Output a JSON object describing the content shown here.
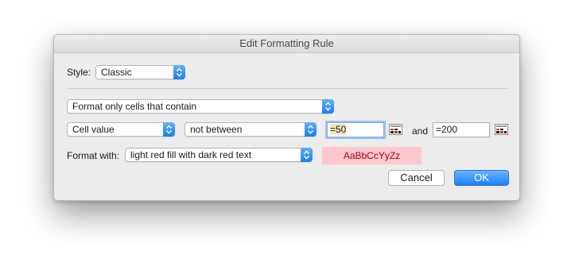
{
  "dialog": {
    "title": "Edit Formatting Rule"
  },
  "style": {
    "label": "Style:",
    "value": "Classic"
  },
  "rule": {
    "type_value": "Format only cells that contain",
    "criteria_value": "Cell value",
    "operator_value": "not between",
    "value1": "=50",
    "and_label": "and",
    "value2": "=200"
  },
  "format": {
    "label": "Format with:",
    "value": "light red fill with dark red text",
    "preview_text": "AaBbCcYyZz",
    "preview_fill_color": "#ffc7ce",
    "preview_text_color": "#9c0006"
  },
  "buttons": {
    "cancel_label": "Cancel",
    "ok_label": "OK"
  },
  "icons": {
    "popup_arrow": "chevron-updown-icon",
    "range_picker": "collapse-dialog-icon"
  }
}
